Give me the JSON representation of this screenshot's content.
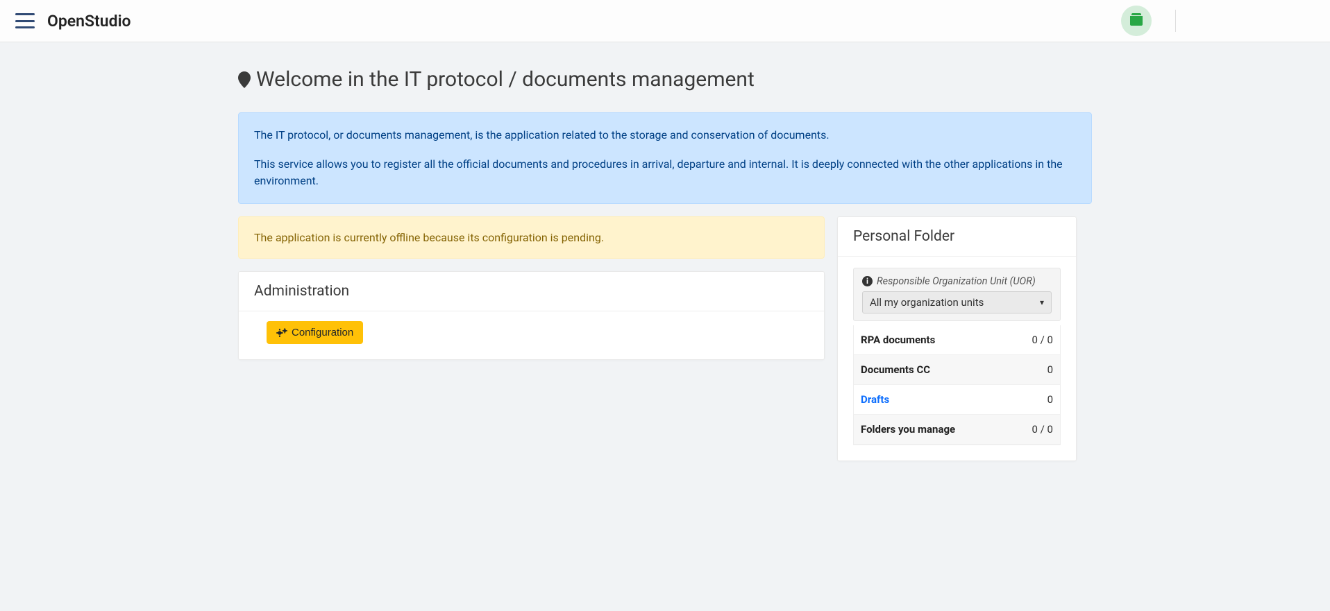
{
  "brand": "OpenStudio",
  "page_title": "Welcome in the IT protocol / documents management",
  "info_alert": {
    "p1": "The IT protocol, or documents management, is the application related to the storage and conservation of documents.",
    "p2": "This service allows you to register all the official documents and procedures in arrival, departure and internal. It is deeply connected with the other applications in the environment."
  },
  "warning_alert": "The application is currently offline because its configuration is pending.",
  "admin": {
    "title": "Administration",
    "config_button": "Configuration"
  },
  "personal_folder": {
    "title": "Personal Folder",
    "uor_label": "Responsible Organization Unit (UOR)",
    "uor_selected": "All my organization units",
    "rows": [
      {
        "label": "RPA documents",
        "value": "0 / 0",
        "link": false
      },
      {
        "label": "Documents CC",
        "value": "0",
        "link": false
      },
      {
        "label": "Drafts",
        "value": "0",
        "link": true
      },
      {
        "label": "Folders you manage",
        "value": "0 / 0",
        "link": false
      }
    ]
  }
}
